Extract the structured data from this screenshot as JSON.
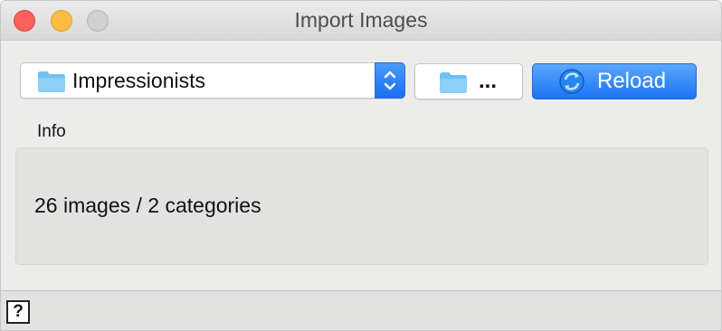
{
  "window": {
    "title": "Import Images"
  },
  "toolbar": {
    "directory_value": "Impressionists",
    "browse_label": "...",
    "reload_label": "Reload"
  },
  "info": {
    "heading": "Info",
    "summary": "26 images / 2 categories"
  },
  "statusbar": {
    "help_label": "?"
  },
  "icons": {
    "directory": "folder-icon",
    "browse": "folder-icon",
    "stepper": "chevron-up-down-icon",
    "reload": "refresh-icon"
  },
  "colors": {
    "accent": "#1b73f4",
    "close": "#fc605b",
    "minimize": "#fdbc40",
    "zoom": "#d0d0d0"
  }
}
